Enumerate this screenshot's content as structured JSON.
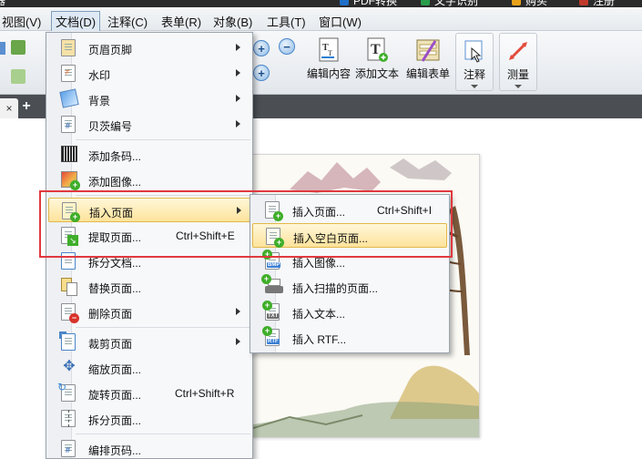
{
  "titlebar": {
    "items": [
      {
        "label": "PDF转换",
        "color": "#1f6fc9"
      },
      {
        "label": "文字识别",
        "color": "#2a9d4b"
      },
      {
        "label": "购买",
        "color": "#e7a21a"
      },
      {
        "label": "注册",
        "color": "#c0392b"
      }
    ]
  },
  "menubar": {
    "items": [
      "视图(V)",
      "文档(D)",
      "注释(C)",
      "表单(R)",
      "对象(B)",
      "工具(T)",
      "窗口(W)"
    ]
  },
  "ribbon": {
    "buttons": [
      {
        "label": "编辑内容",
        "icon": "edit-content-icon"
      },
      {
        "label": "添加文本",
        "icon": "add-text-icon"
      },
      {
        "label": "编辑表单",
        "icon": "edit-form-icon"
      },
      {
        "label": "注释",
        "icon": "annotate-icon"
      },
      {
        "label": "测量",
        "icon": "measure-icon"
      }
    ],
    "zoom_in": "+",
    "zoom_out": "−",
    "zoom_in2": "+"
  },
  "tabs": {
    "close_glyph": "×",
    "add_glyph": "+"
  },
  "doc_menu": {
    "items": [
      {
        "label": "页眉页脚",
        "submenu": true,
        "icon": "header-footer-icon"
      },
      {
        "label": "水印",
        "submenu": true,
        "icon": "watermark-icon"
      },
      {
        "label": "背景",
        "submenu": true,
        "icon": "background-icon"
      },
      {
        "label": "贝茨编号",
        "submenu": true,
        "icon": "bates-number-icon"
      },
      {
        "label": "添加条码...",
        "submenu": false,
        "icon": "barcode-icon"
      },
      {
        "label": "添加图像...",
        "submenu": false,
        "icon": "add-image-icon"
      },
      {
        "label": "插入页面",
        "submenu": true,
        "icon": "insert-page-icon"
      },
      {
        "label": "提取页面...",
        "shortcut": "Ctrl+Shift+E",
        "submenu": false,
        "icon": "extract-page-icon"
      },
      {
        "label": "拆分文档...",
        "submenu": false,
        "icon": "split-document-icon"
      },
      {
        "label": "替换页面...",
        "submenu": false,
        "icon": "replace-page-icon"
      },
      {
        "label": "删除页面",
        "submenu": true,
        "icon": "delete-page-icon"
      },
      {
        "label": "裁剪页面",
        "submenu": true,
        "icon": "crop-page-icon"
      },
      {
        "label": "缩放页面...",
        "submenu": false,
        "icon": "resize-page-icon"
      },
      {
        "label": "旋转页面...",
        "shortcut": "Ctrl+Shift+R",
        "submenu": false,
        "icon": "rotate-page-icon"
      },
      {
        "label": "拆分页面...",
        "submenu": false,
        "icon": "split-page-icon"
      },
      {
        "label": "编排页码...",
        "submenu": false,
        "icon": "page-numbering-icon"
      }
    ]
  },
  "insert_submenu": {
    "items": [
      {
        "label": "插入页面...",
        "shortcut": "Ctrl+Shift+I",
        "icon": "insert-page-file-icon"
      },
      {
        "label": "插入空白页面...",
        "icon": "insert-blank-page-icon"
      },
      {
        "label": "插入图像...",
        "icon": "insert-image-icon",
        "tag": "BMP"
      },
      {
        "label": "插入扫描的页面...",
        "icon": "insert-scanned-page-icon"
      },
      {
        "label": "插入文本...",
        "icon": "insert-text-icon",
        "tag": "TXT"
      },
      {
        "label": "插入 RTF...",
        "icon": "insert-rtf-icon",
        "tag": "RTF"
      }
    ]
  },
  "colors": {
    "highlight_border": "#e0393e",
    "menu_hover_start": "#fff7d9",
    "menu_hover_end": "#fde39b",
    "badge_green": "#3fae2a",
    "badge_red": "#d8332b"
  }
}
